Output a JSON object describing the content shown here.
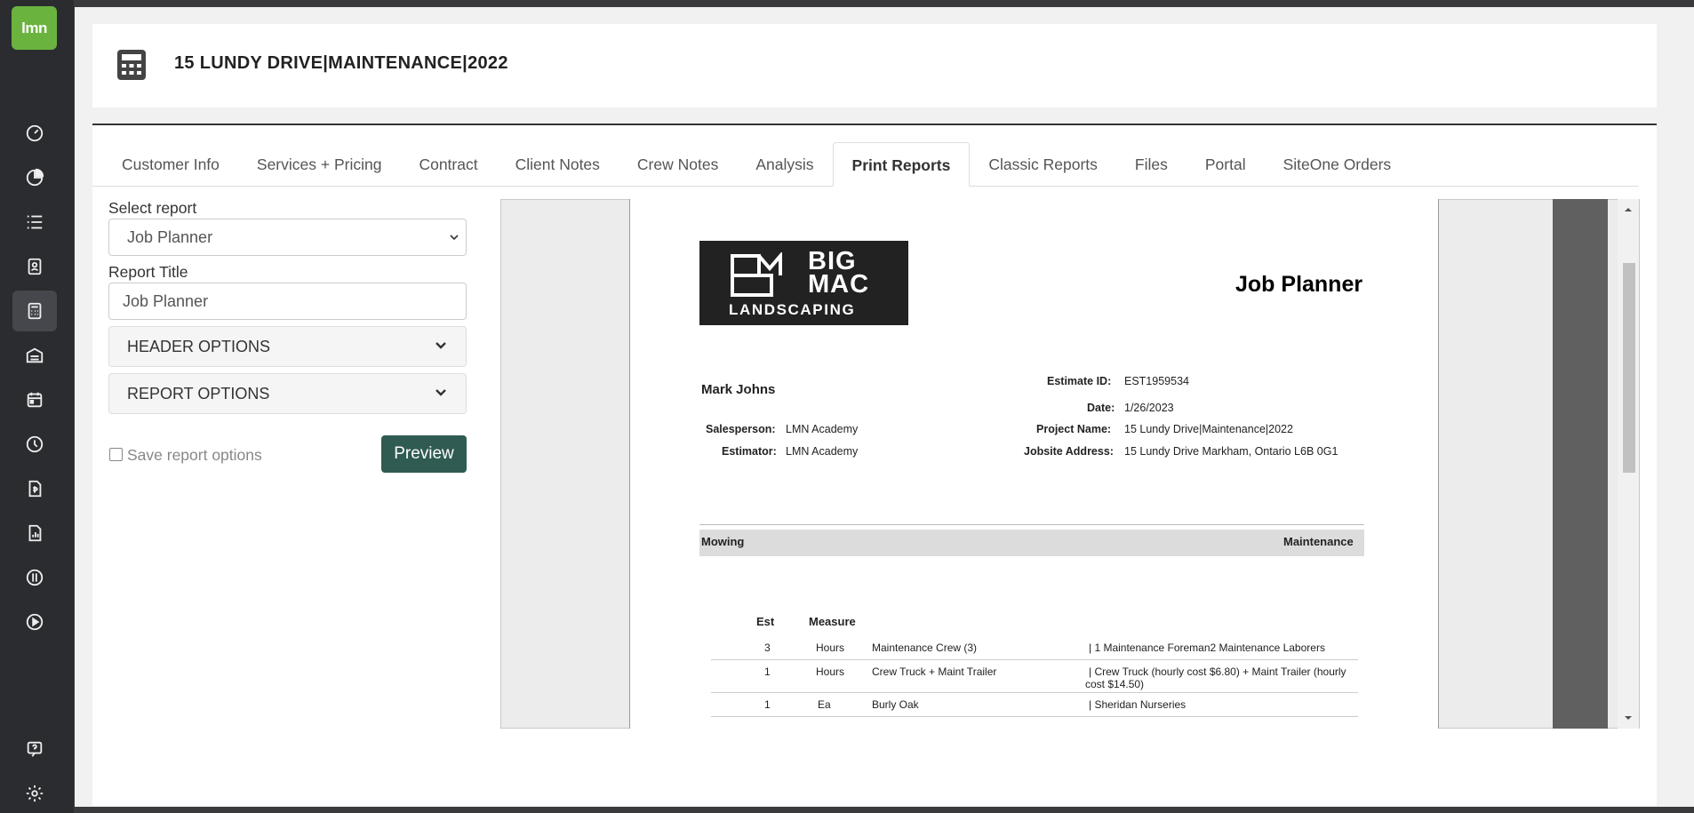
{
  "app": {
    "logo_text": "lmn"
  },
  "nav": {
    "icons": [
      "dashboard-icon",
      "pie-chart-icon",
      "list-icon",
      "contacts-icon",
      "calculator-icon",
      "warehouse-icon",
      "calendar-icon",
      "clock-icon",
      "invoice-icon",
      "report-icon",
      "quickbooks-icon",
      "play-icon",
      "help-icon",
      "settings-icon"
    ]
  },
  "header": {
    "title": "15 LUNDY DRIVE|MAINTENANCE|2022"
  },
  "tabs": [
    {
      "label": "Customer Info"
    },
    {
      "label": "Services + Pricing"
    },
    {
      "label": "Contract"
    },
    {
      "label": "Client Notes"
    },
    {
      "label": "Crew Notes"
    },
    {
      "label": "Analysis"
    },
    {
      "label": "Print Reports"
    },
    {
      "label": "Classic Reports"
    },
    {
      "label": "Files"
    },
    {
      "label": "Portal"
    },
    {
      "label": "SiteOne Orders"
    }
  ],
  "form": {
    "select_report_label": "Select report",
    "select_report_value": "Job Planner",
    "report_title_label": "Report Title",
    "report_title_value": "Job Planner",
    "header_options": "HEADER OPTIONS",
    "report_options": "REPORT OPTIONS",
    "save_options_label": "Save report options",
    "preview_label": "Preview"
  },
  "report": {
    "brand_line1": "BIG",
    "brand_line2": "MAC",
    "brand_line3": "LANDSCAPING",
    "heading": "Job Planner",
    "client_name": "Mark Johns",
    "salesperson_label": "Salesperson:",
    "salesperson": "LMN Academy",
    "estimator_label": "Estimator:",
    "estimator": "LMN Academy",
    "estimate_id_label": "Estimate ID:",
    "estimate_id": "EST1959534",
    "date_label": "Date:",
    "date": "1/26/2023",
    "project_name_label": "Project Name:",
    "project_name": "15 Lundy Drive|Maintenance|2022",
    "jobsite_label": "Jobsite Address:",
    "jobsite": "15 Lundy Drive Markham, Ontario L6B 0G1",
    "section_left": "Mowing",
    "section_right": "Maintenance",
    "col_est": "Est",
    "col_measure": "Measure",
    "rows": [
      {
        "est": "3",
        "measure": "Hours",
        "item": "Maintenance Crew (3)",
        "detail": "| 1 Maintenance Foreman2 Maintenance Laborers",
        "detail2": ""
      },
      {
        "est": "1",
        "measure": "Hours",
        "item": "Crew Truck + Maint Trailer",
        "detail": "| Crew Truck (hourly cost $6.80) + Maint Trailer (hourly",
        "detail2": "cost $14.50)"
      },
      {
        "est": "1",
        "measure": "Ea",
        "item": "Burly Oak",
        "detail": "| Sheridan Nurseries",
        "detail2": ""
      }
    ]
  }
}
